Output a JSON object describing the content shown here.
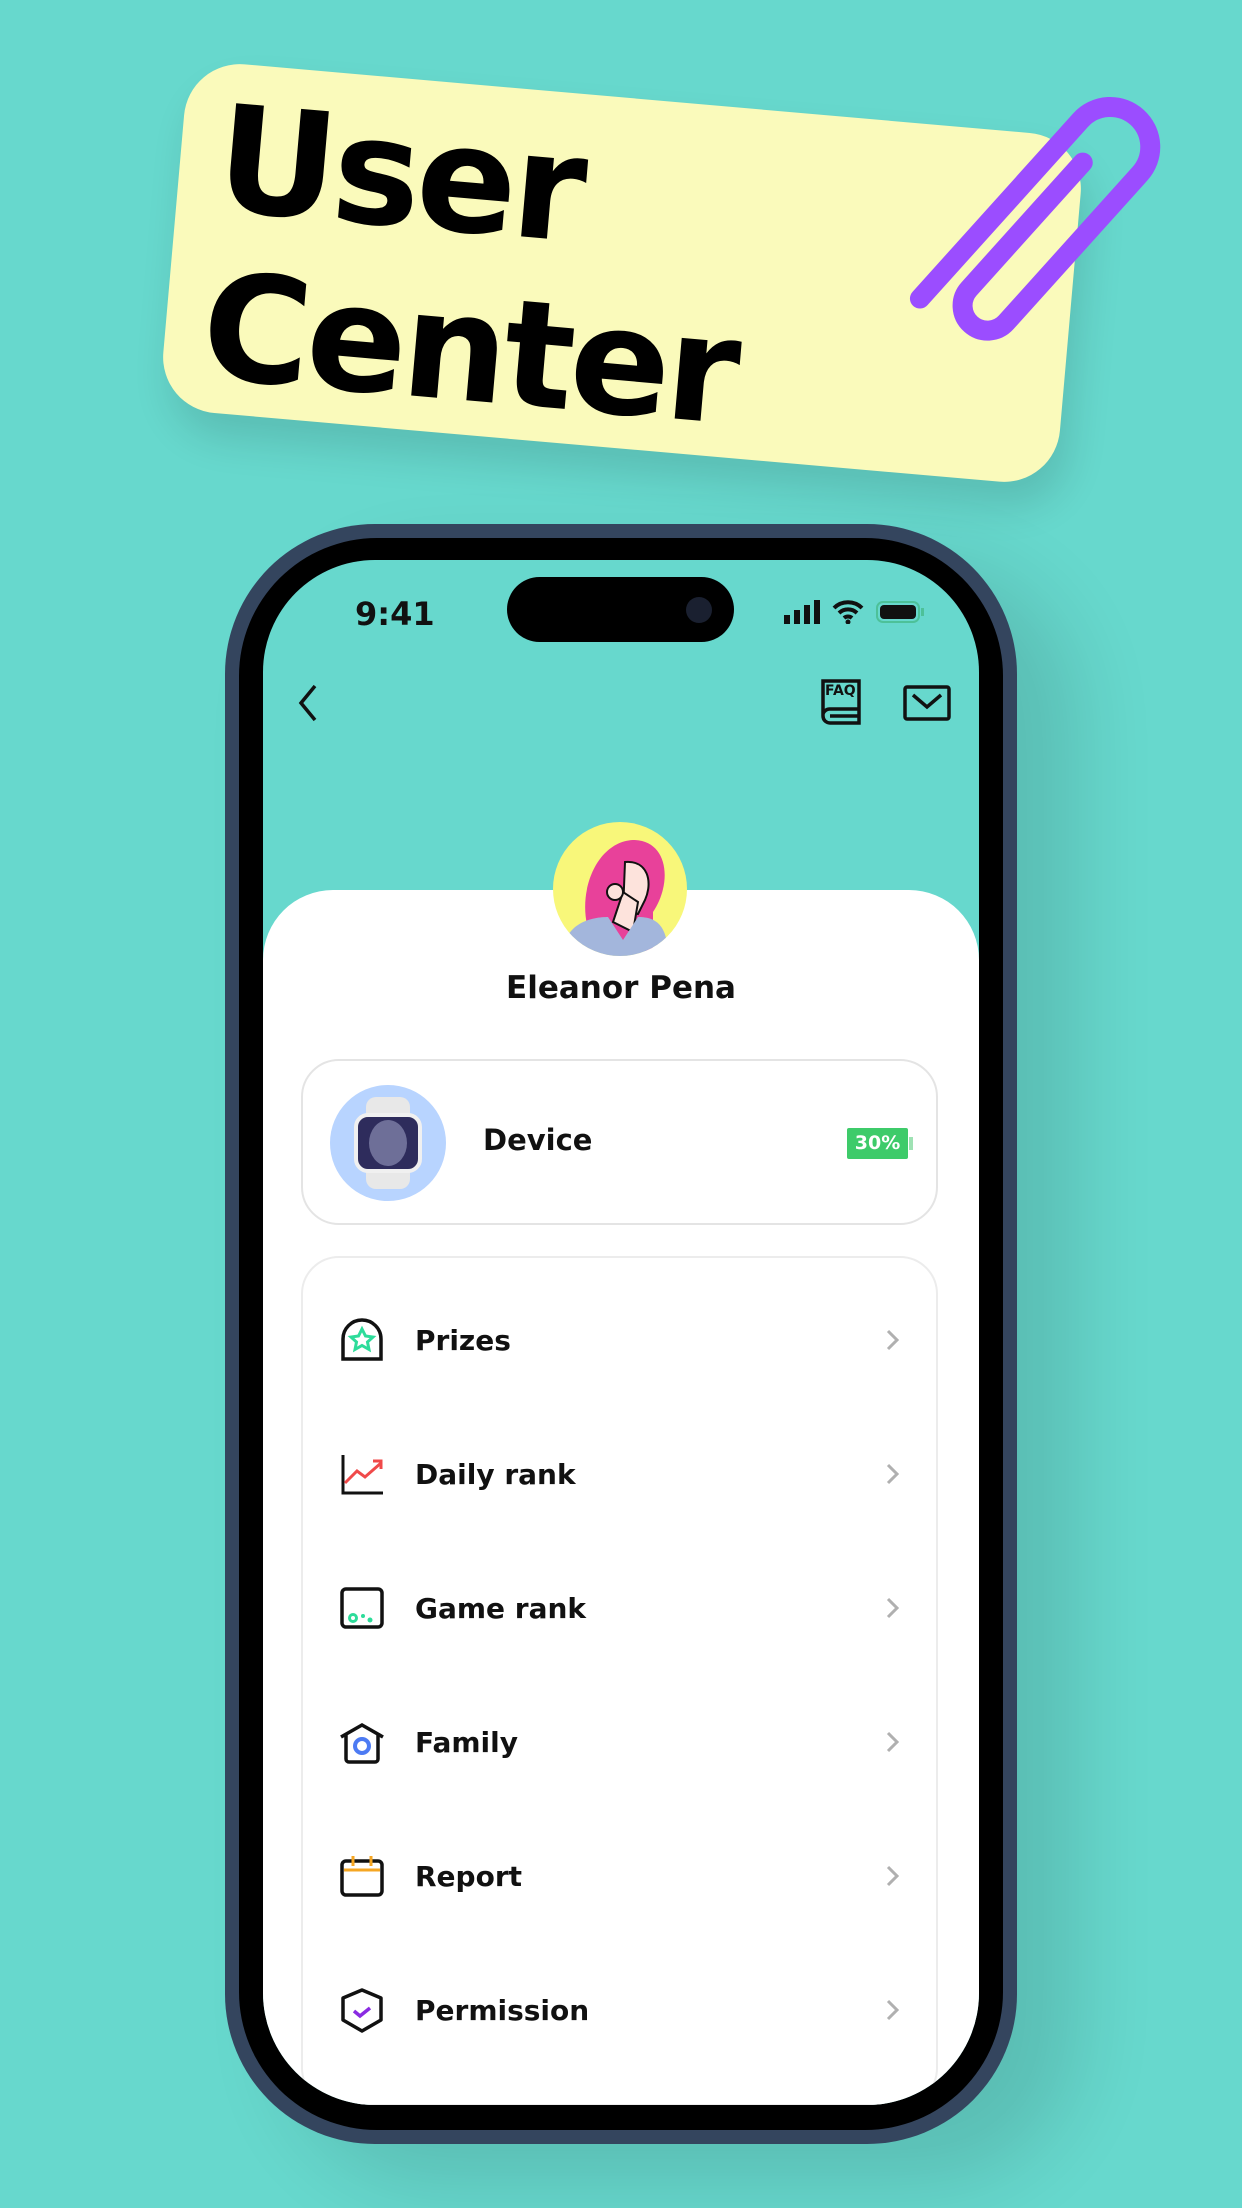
{
  "banner": {
    "title_line1": "User",
    "title_line2": "Center"
  },
  "status_bar": {
    "time": "9:41"
  },
  "nav": {
    "back": "back",
    "faq_label": "FAQ"
  },
  "profile": {
    "name": "Eleanor Pena"
  },
  "device": {
    "label": "Device",
    "battery": "30%",
    "battery_percent": 30
  },
  "menu": {
    "items": [
      {
        "label": "Prizes",
        "icon": "prize-star-icon",
        "color": "#2ddc9a"
      },
      {
        "label": "Daily rank",
        "icon": "trend-chart-icon",
        "color": "#f04a4a"
      },
      {
        "label": "Game rank",
        "icon": "game-icon",
        "color": "#2ddc9a"
      },
      {
        "label": "Family",
        "icon": "home-icon",
        "color": "#4d7bf3"
      },
      {
        "label": "Report",
        "icon": "calendar-icon",
        "color": "#f5a623"
      },
      {
        "label": "Permission",
        "icon": "shield-check-icon",
        "color": "#8a2be2"
      }
    ]
  },
  "colors": {
    "background": "#67d8cd",
    "sticky": "#fafabb",
    "clip": "#9b4dff",
    "battery": "#3ecb6a"
  }
}
